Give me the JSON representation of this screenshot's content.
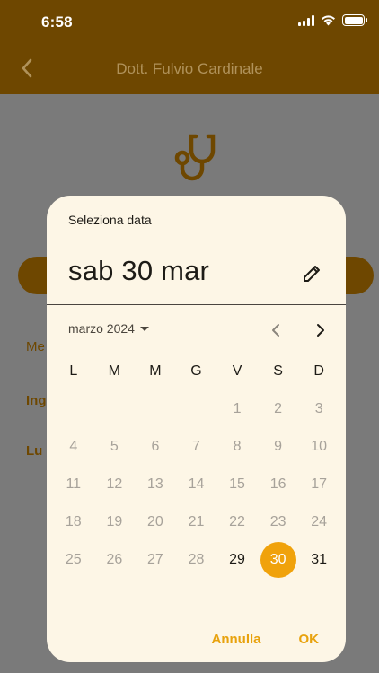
{
  "status": {
    "time": "6:58"
  },
  "appbar": {
    "title": "Dott. Fulvio Cardinale"
  },
  "background": {
    "label1": "Me",
    "label2": "Ing",
    "label3": "Lu"
  },
  "dialog": {
    "header": "Seleziona data",
    "selected_date": "sab 30 mar",
    "month_label": "marzo 2024",
    "weekdays": [
      "L",
      "M",
      "M",
      "G",
      "V",
      "S",
      "D"
    ],
    "weeks": [
      [
        "",
        "",
        "",
        "",
        "1",
        "2",
        "3"
      ],
      [
        "4",
        "5",
        "6",
        "7",
        "8",
        "9",
        "10"
      ],
      [
        "11",
        "12",
        "13",
        "14",
        "15",
        "16",
        "17"
      ],
      [
        "18",
        "19",
        "20",
        "21",
        "22",
        "23",
        "24"
      ],
      [
        "25",
        "26",
        "27",
        "28",
        "29",
        "30",
        "31"
      ]
    ],
    "enabled_days": [
      "29",
      "30",
      "31"
    ],
    "selected_day": "30",
    "cancel_label": "Annulla",
    "ok_label": "OK"
  },
  "colors": {
    "accent": "#f0a20b",
    "brand": "#6e4700",
    "surface": "#fdf6e6"
  }
}
